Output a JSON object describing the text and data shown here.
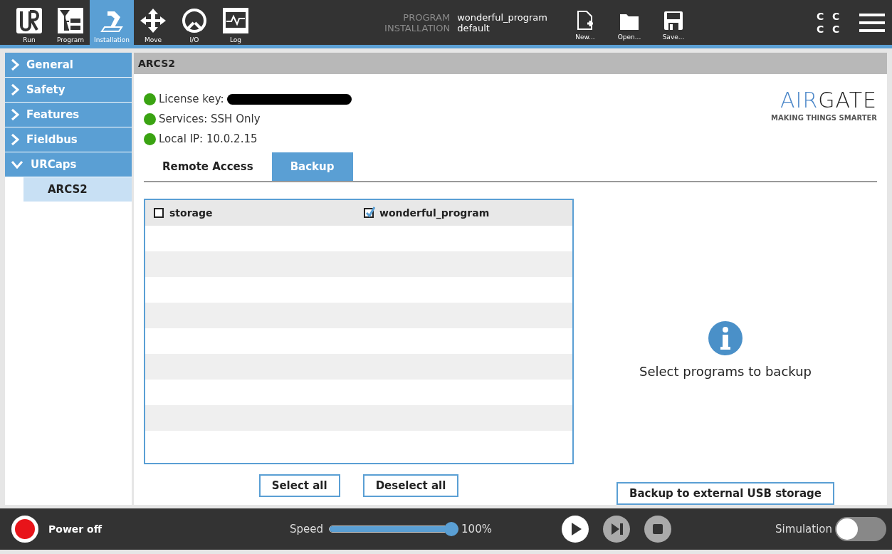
{
  "nav": [
    {
      "label": "Run",
      "selected": false
    },
    {
      "label": "Program",
      "selected": false
    },
    {
      "label": "Installation",
      "selected": true
    },
    {
      "label": "Move",
      "selected": false
    },
    {
      "label": "I/O",
      "selected": false
    },
    {
      "label": "Log",
      "selected": false
    }
  ],
  "program_info": [
    {
      "label": "PROGRAM",
      "value": "wonderful_program"
    },
    {
      "label": "INSTALLATION",
      "value": "default"
    }
  ],
  "file_buttons": [
    "New...",
    "Open...",
    "Save..."
  ],
  "status_marks": [
    "C",
    "C",
    "C",
    "C"
  ],
  "sidebar": {
    "items": [
      {
        "label": "General",
        "expanded": false
      },
      {
        "label": "Safety",
        "expanded": false
      },
      {
        "label": "Features",
        "expanded": false
      },
      {
        "label": "Fieldbus",
        "expanded": false
      },
      {
        "label": "URCaps",
        "expanded": true,
        "children": [
          {
            "label": "ARCS2",
            "selected": true
          }
        ]
      }
    ]
  },
  "panel_title": "ARCS2",
  "status_lines": [
    {
      "label": "License key:",
      "redacted": true,
      "color": "#3aa312"
    },
    {
      "label": "Services: SSH Only",
      "color": "#3aa312"
    },
    {
      "label": "Local IP: 10.0.2.15",
      "color": "#3aa312"
    }
  ],
  "logo": {
    "lead": "AIR",
    "rest": "GATE",
    "tagline": "MAKING THINGS SMARTER"
  },
  "tabs": [
    {
      "label": "Remote Access",
      "selected": false
    },
    {
      "label": "Backup",
      "selected": true
    }
  ],
  "programs": [
    {
      "label": "storage",
      "checked": false
    },
    {
      "label": "wonderful_program",
      "checked": true
    }
  ],
  "hint": "Select programs to backup",
  "list_buttons": [
    "Select all",
    "Deselect all"
  ],
  "backup_button": "Backup to external USB storage",
  "footer": {
    "power": "Power off",
    "speed_label": "Speed",
    "speed": {
      "level": 1.0
    },
    "speed_reading": "100%",
    "simulation": "Simulation",
    "simulation_on": false
  }
}
